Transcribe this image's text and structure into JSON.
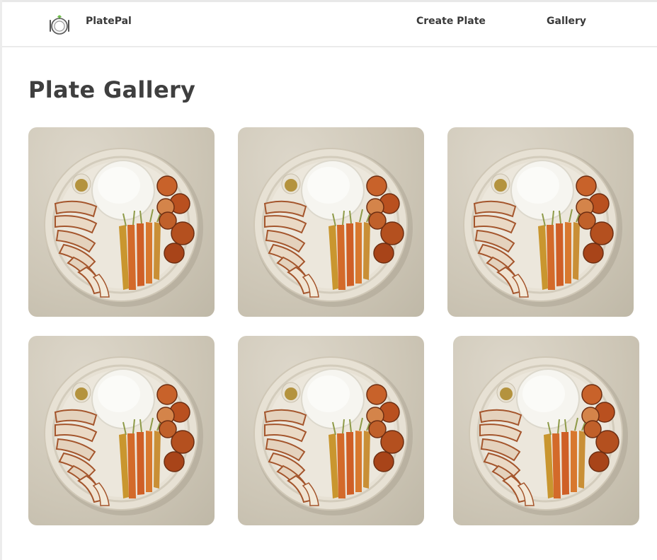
{
  "app": {
    "name": "PlatePal",
    "logo_icon": "plate-cutlery-icon"
  },
  "nav": {
    "links": [
      {
        "label": "Create Plate"
      },
      {
        "label": "Gallery"
      }
    ]
  },
  "page": {
    "title": "Plate Gallery"
  },
  "gallery": {
    "items": [
      {
        "name": "plate-image-1"
      },
      {
        "name": "plate-image-2"
      },
      {
        "name": "plate-image-3"
      },
      {
        "name": "plate-image-4"
      },
      {
        "name": "plate-image-5"
      },
      {
        "name": "plate-image-6"
      }
    ]
  },
  "colors": {
    "text": "#3d3d3d",
    "background": "#ffffff",
    "navbar_border": "#ebebeb"
  }
}
